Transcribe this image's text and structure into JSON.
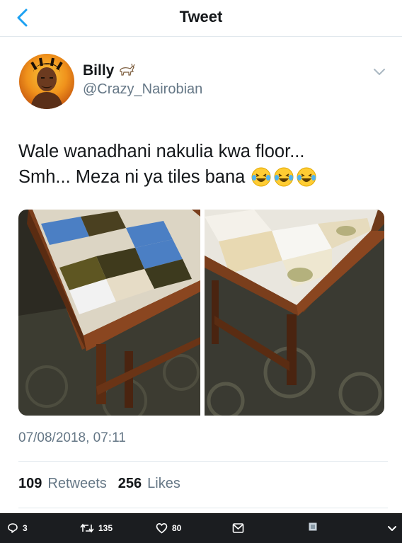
{
  "header": {
    "title": "Tweet"
  },
  "user": {
    "name": "Billy",
    "handle": "@Crazy_Nairobian"
  },
  "tweet": {
    "line1": "Wale wanadhani nakulia kwa floor...",
    "line2": "Smh... Meza ni ya tiles bana",
    "timestamp": "07/08/2018, 07:11"
  },
  "stats": {
    "retweets_count": "109",
    "retweets_label": "Retweets",
    "likes_count": "256",
    "likes_label": "Likes"
  },
  "actions": {
    "replies": "3",
    "retweets": "135",
    "likes": "80"
  },
  "colors": {
    "accent": "#1da1f2",
    "secondary_text": "#657786",
    "bar_bg": "#1b1d20"
  },
  "icons": [
    "back-arrow-icon",
    "goat-emoji-icon",
    "chevron-down-icon",
    "laughing-emoji-icon",
    "reply-icon",
    "retweet-icon",
    "heart-icon",
    "message-icon",
    "media-icon",
    "expand-icon"
  ]
}
